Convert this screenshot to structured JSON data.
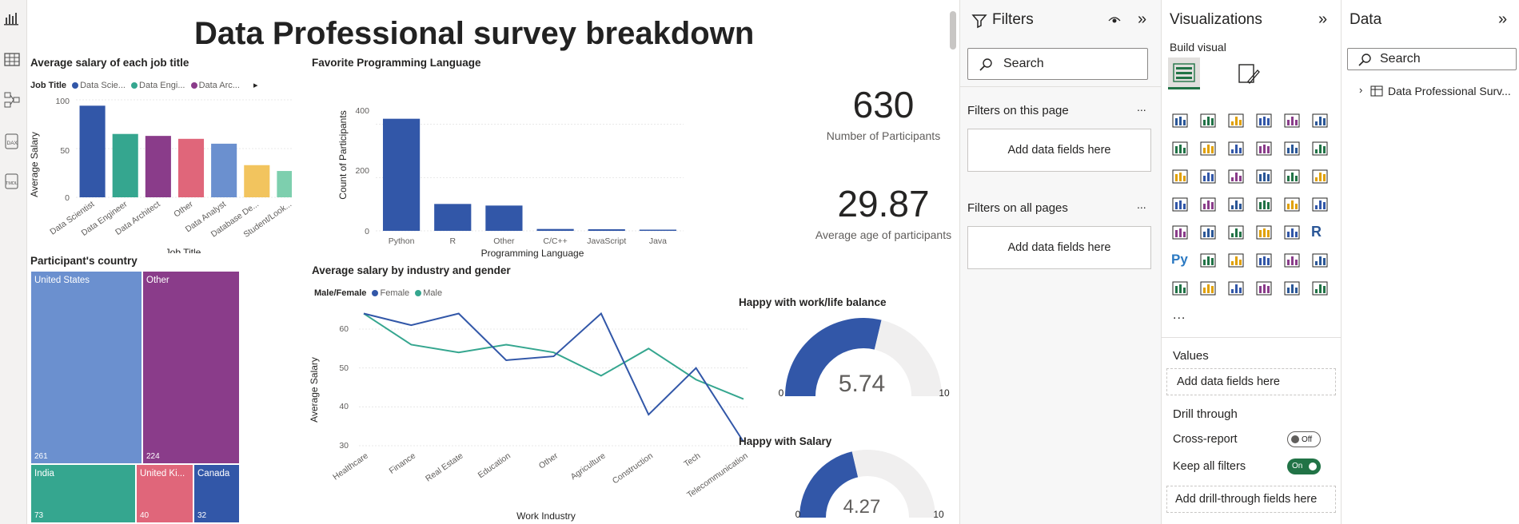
{
  "report": {
    "title": "Data Professional survey breakdown"
  },
  "left_rail": {
    "icons": [
      "report-view-icon",
      "table-view-icon",
      "model-view-icon",
      "dax-query-icon",
      "tmdl-view-icon"
    ],
    "dax_label": "DAX",
    "tmdl_label": "TMDL"
  },
  "salary_by_job": {
    "title": "Average salary of each job title",
    "legend_title": "Job Title",
    "legend": [
      {
        "label": "Data Scie...",
        "color": "#3257a8"
      },
      {
        "label": "Data Engi...",
        "color": "#35a68f"
      },
      {
        "label": "Data Arc...",
        "color": "#8a3c8a"
      }
    ],
    "ylabel": "Average Salary",
    "xlabel": "Job Title",
    "yticks": [
      "100",
      "50",
      "0"
    ],
    "chart_data": {
      "type": "bar",
      "categories": [
        "Data Scientist",
        "Data Engineer",
        "Data Architect",
        "Other",
        "Data Analyst",
        "Database De...",
        "Student/Look..."
      ],
      "values": [
        94,
        65,
        63,
        60,
        55,
        33,
        27
      ],
      "colors": [
        "#3257a8",
        "#35a68f",
        "#8a3c8a",
        "#e0667a",
        "#6b90cf",
        "#f2c45e",
        "#7dcfae"
      ],
      "ylim": [
        0,
        100
      ]
    }
  },
  "fav_language": {
    "title": "Favorite Programming Language",
    "ylabel": "Count of Participants",
    "xlabel": "Programming Language",
    "yticks": [
      "400",
      "200",
      "0"
    ],
    "chart_data": {
      "type": "bar",
      "categories": [
        "Python",
        "R",
        "Other",
        "C/C++",
        "JavaScript",
        "Java"
      ],
      "values": [
        421,
        101,
        95,
        7,
        6,
        3
      ],
      "ylim": [
        0,
        450
      ]
    }
  },
  "cards": [
    {
      "value": "630",
      "label": "Number of Participants"
    },
    {
      "value": "29.87",
      "label": "Average age of participants"
    }
  ],
  "country": {
    "title": "Participant's country",
    "chart_data": {
      "type": "treemap",
      "items": [
        {
          "name": "United States",
          "value": 261,
          "color": "#6b90cf"
        },
        {
          "name": "Other",
          "value": 224,
          "color": "#8a3c8a"
        },
        {
          "name": "India",
          "value": 73,
          "color": "#35a68f"
        },
        {
          "name": "United Ki...",
          "value": 40,
          "color": "#e0667a"
        },
        {
          "name": "Canada",
          "value": 32,
          "color": "#3257a8"
        }
      ]
    }
  },
  "salary_industry": {
    "title": "Average salary by industry and gender",
    "legend_title": "Male/Female",
    "legend": [
      {
        "label": "Female",
        "color": "#3257a8"
      },
      {
        "label": "Male",
        "color": "#35a68f"
      }
    ],
    "ylabel": "Average Salary",
    "xlabel": "Work Industry",
    "yticks": [
      "60",
      "50",
      "40",
      "30"
    ],
    "chart_data": {
      "type": "line",
      "categories": [
        "Healthcare",
        "Finance",
        "Real Estate",
        "Education",
        "Other",
        "Agriculture",
        "Construction",
        "Tech",
        "Telecommunication"
      ],
      "series": [
        {
          "name": "Female",
          "color": "#3257a8",
          "values": [
            64,
            61,
            64,
            52,
            53,
            64,
            38,
            50,
            31
          ]
        },
        {
          "name": "Male",
          "color": "#35a68f",
          "values": [
            64,
            56,
            54,
            56,
            54,
            48,
            55,
            47,
            42
          ]
        }
      ],
      "ylim": [
        30,
        66
      ]
    }
  },
  "gauges": [
    {
      "title": "Happy with work/life balance",
      "value": "5.74",
      "min": "0",
      "max": "10",
      "fraction": 0.574
    },
    {
      "title": "Happy with Salary",
      "value": "4.27",
      "min": "0",
      "max": "10",
      "fraction": 0.427
    }
  ],
  "filters_pane": {
    "title": "Filters",
    "search_placeholder": "Search",
    "on_page_label": "Filters on this page",
    "on_page_drop": "Add data fields here",
    "all_pages_label": "Filters on all pages",
    "all_pages_drop": "Add data fields here",
    "more": "..."
  },
  "viz_pane": {
    "title": "Visualizations",
    "build_visual": "Build visual",
    "more": "...",
    "values_label": "Values",
    "values_drop": "Add data fields here",
    "drill_label": "Drill through",
    "cross_report": "Cross-report",
    "cross_toggle": "Off",
    "keep_filters": "Keep all filters",
    "keep_toggle": "On",
    "drill_drop": "Add drill-through fields here",
    "r_label": "R",
    "py_label": "Py"
  },
  "data_pane": {
    "title": "Data",
    "search_placeholder": "Search",
    "table_name": "Data Professional Surv..."
  }
}
